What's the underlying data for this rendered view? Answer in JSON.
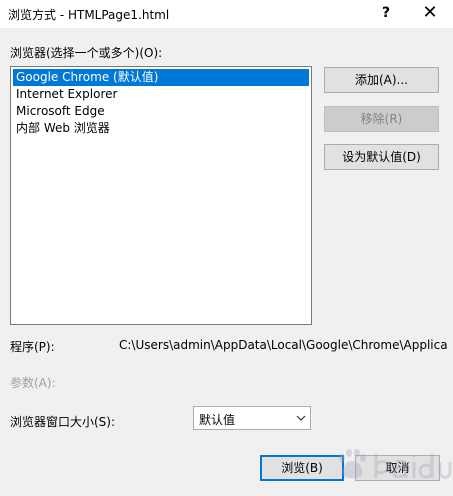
{
  "window": {
    "title": "浏览方式 - HTMLPage1.html",
    "help_glyph": "?",
    "close_glyph": "✕"
  },
  "browsers": {
    "label": "浏览器(选择一个或多个)(O):",
    "items": [
      {
        "label": "Google Chrome (默认值)",
        "selected": true
      },
      {
        "label": "Internet Explorer",
        "selected": false
      },
      {
        "label": "Microsoft Edge",
        "selected": false
      },
      {
        "label": "内部 Web 浏览器",
        "selected": false
      }
    ]
  },
  "actions": {
    "add_label": "添加(A)...",
    "remove_label": "移除(R)",
    "set_default_label": "设为默认值(D)"
  },
  "program": {
    "label": "程序(P):",
    "value": "C:\\Users\\admin\\AppData\\Local\\Google\\Chrome\\Applica"
  },
  "arguments": {
    "label": "参数(A):"
  },
  "window_size": {
    "label": "浏览器窗口大小(S):",
    "selected": "默认值"
  },
  "footer": {
    "browse_label": "浏览(B)",
    "cancel_label": "取消"
  },
  "colors": {
    "selection": "#0078d7",
    "dialog_bg": "#f0f0f0",
    "disabled_text": "#a0a0a0"
  }
}
